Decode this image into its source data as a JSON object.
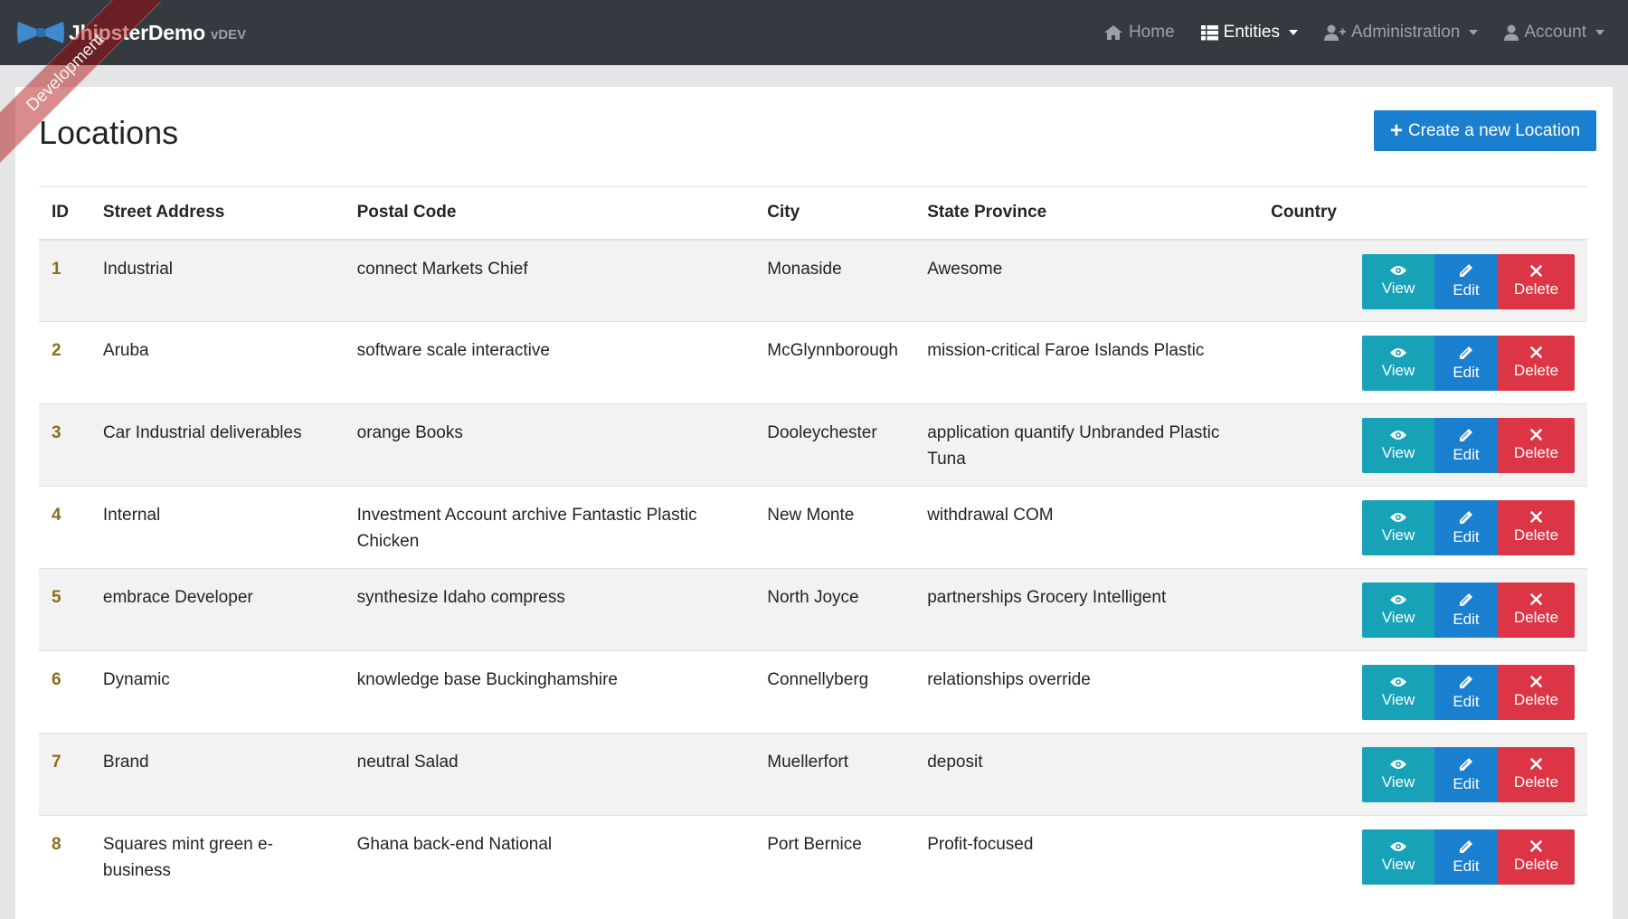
{
  "brand": {
    "name": "JhipsterDemo",
    "version": "vDEV"
  },
  "ribbon": {
    "label": "Development"
  },
  "nav": {
    "home": "Home",
    "entities": "Entities",
    "administration": "Administration",
    "account": "Account"
  },
  "page": {
    "title": "Locations",
    "create_label": "Create a new Location"
  },
  "table": {
    "headers": {
      "id": "ID",
      "street": "Street Address",
      "postal": "Postal Code",
      "city": "City",
      "state": "State Province",
      "country": "Country"
    },
    "rows": [
      {
        "id": "1",
        "street": "Industrial",
        "postal": "connect Markets Chief",
        "city": "Monaside",
        "state": "Awesome",
        "country": ""
      },
      {
        "id": "2",
        "street": "Aruba",
        "postal": "software scale interactive",
        "city": "McGlynnborough",
        "state": "mission-critical Faroe Islands Plastic",
        "country": ""
      },
      {
        "id": "3",
        "street": "Car Industrial deliverables",
        "postal": "orange Books",
        "city": "Dooleychester",
        "state": "application quantify Unbranded Plastic Tuna",
        "country": ""
      },
      {
        "id": "4",
        "street": "Internal",
        "postal": "Investment Account archive Fantastic Plastic Chicken",
        "city": "New Monte",
        "state": "withdrawal COM",
        "country": ""
      },
      {
        "id": "5",
        "street": "embrace Developer",
        "postal": "synthesize Idaho compress",
        "city": "North Joyce",
        "state": "partnerships Grocery Intelligent",
        "country": ""
      },
      {
        "id": "6",
        "street": "Dynamic",
        "postal": "knowledge base Buckinghamshire",
        "city": "Connellyberg",
        "state": "relationships override",
        "country": ""
      },
      {
        "id": "7",
        "street": "Brand",
        "postal": "neutral Salad",
        "city": "Muellerfort",
        "state": "deposit",
        "country": ""
      },
      {
        "id": "8",
        "street": "Squares mint green e-business",
        "postal": "Ghana back-end National",
        "city": "Port Bernice",
        "state": "Profit-focused",
        "country": ""
      }
    ]
  },
  "actions": {
    "view": "View",
    "edit": "Edit",
    "delete": "Delete"
  },
  "icons": {
    "home": "home-icon",
    "entities": "th-list-icon",
    "administration": "user-plus-icon",
    "account": "user-icon",
    "view": "eye-icon",
    "edit": "pencil-icon",
    "delete": "times-icon"
  },
  "colors": {
    "navbar": "#343a40",
    "primary": "#1a7fcf",
    "info": "#17a2b8",
    "danger": "#dc3545"
  }
}
